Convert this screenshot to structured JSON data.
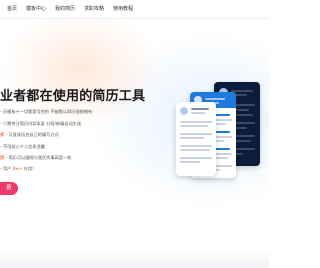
{
  "nav": {
    "items": [
      "首页",
      "模板中心",
      "我的简历",
      "求职攻略",
      "使用教程"
    ]
  },
  "hero": {
    "title": "业者都在使用的简历工具",
    "features": [
      {
        "text": "历模板十一切都是可控的 不被默认简历限制拥有"
      },
      {
        "text": "只需关注简历内容本身 分段/新编自动生成"
      },
      {
        "prefix": "式",
        "text": "可直接适合自己的编写方式"
      },
      {
        "text": "不用担心个人信息泄露"
      },
      {
        "prefix": "页",
        "text": "简历可以跟随与我优秀事高度一致"
      },
      {
        "text": "用户",
        "accent": "8w+",
        "suffix": "在用！"
      }
    ],
    "cta_label": "历"
  },
  "colors": {
    "accent": "#f0622c",
    "cta": "#ee3b6a",
    "resume_blue": "#1f7ae0",
    "resume_dark": "#0c1d3b"
  }
}
